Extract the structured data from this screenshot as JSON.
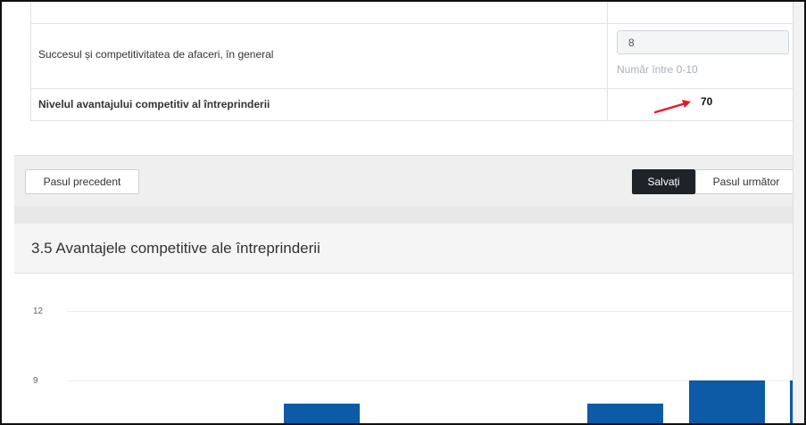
{
  "form": {
    "row1_label": "Succesul și competitivitatea de afaceri, în general",
    "row1_value": "8",
    "row1_hint": "Număr între 0-10",
    "total_label": "Nivelul avantajului competitiv al întreprinderii",
    "total_value": "70"
  },
  "footer": {
    "prev_label": "Pasul precedent",
    "save_label": "Salvați",
    "next_label": "Pasul următor"
  },
  "panel": {
    "title": "3.5 Avantajele competitive ale întreprinderii"
  },
  "chart_data": {
    "type": "bar",
    "ylim": [
      0,
      12
    ],
    "y_ticks": [
      "12",
      "9"
    ],
    "values": [
      8,
      8,
      9,
      9
    ],
    "color": "#0d5aa7",
    "grid": true
  },
  "colors": {
    "annotation_arrow": "#e8192c",
    "save_button_bg": "#1e2329"
  }
}
